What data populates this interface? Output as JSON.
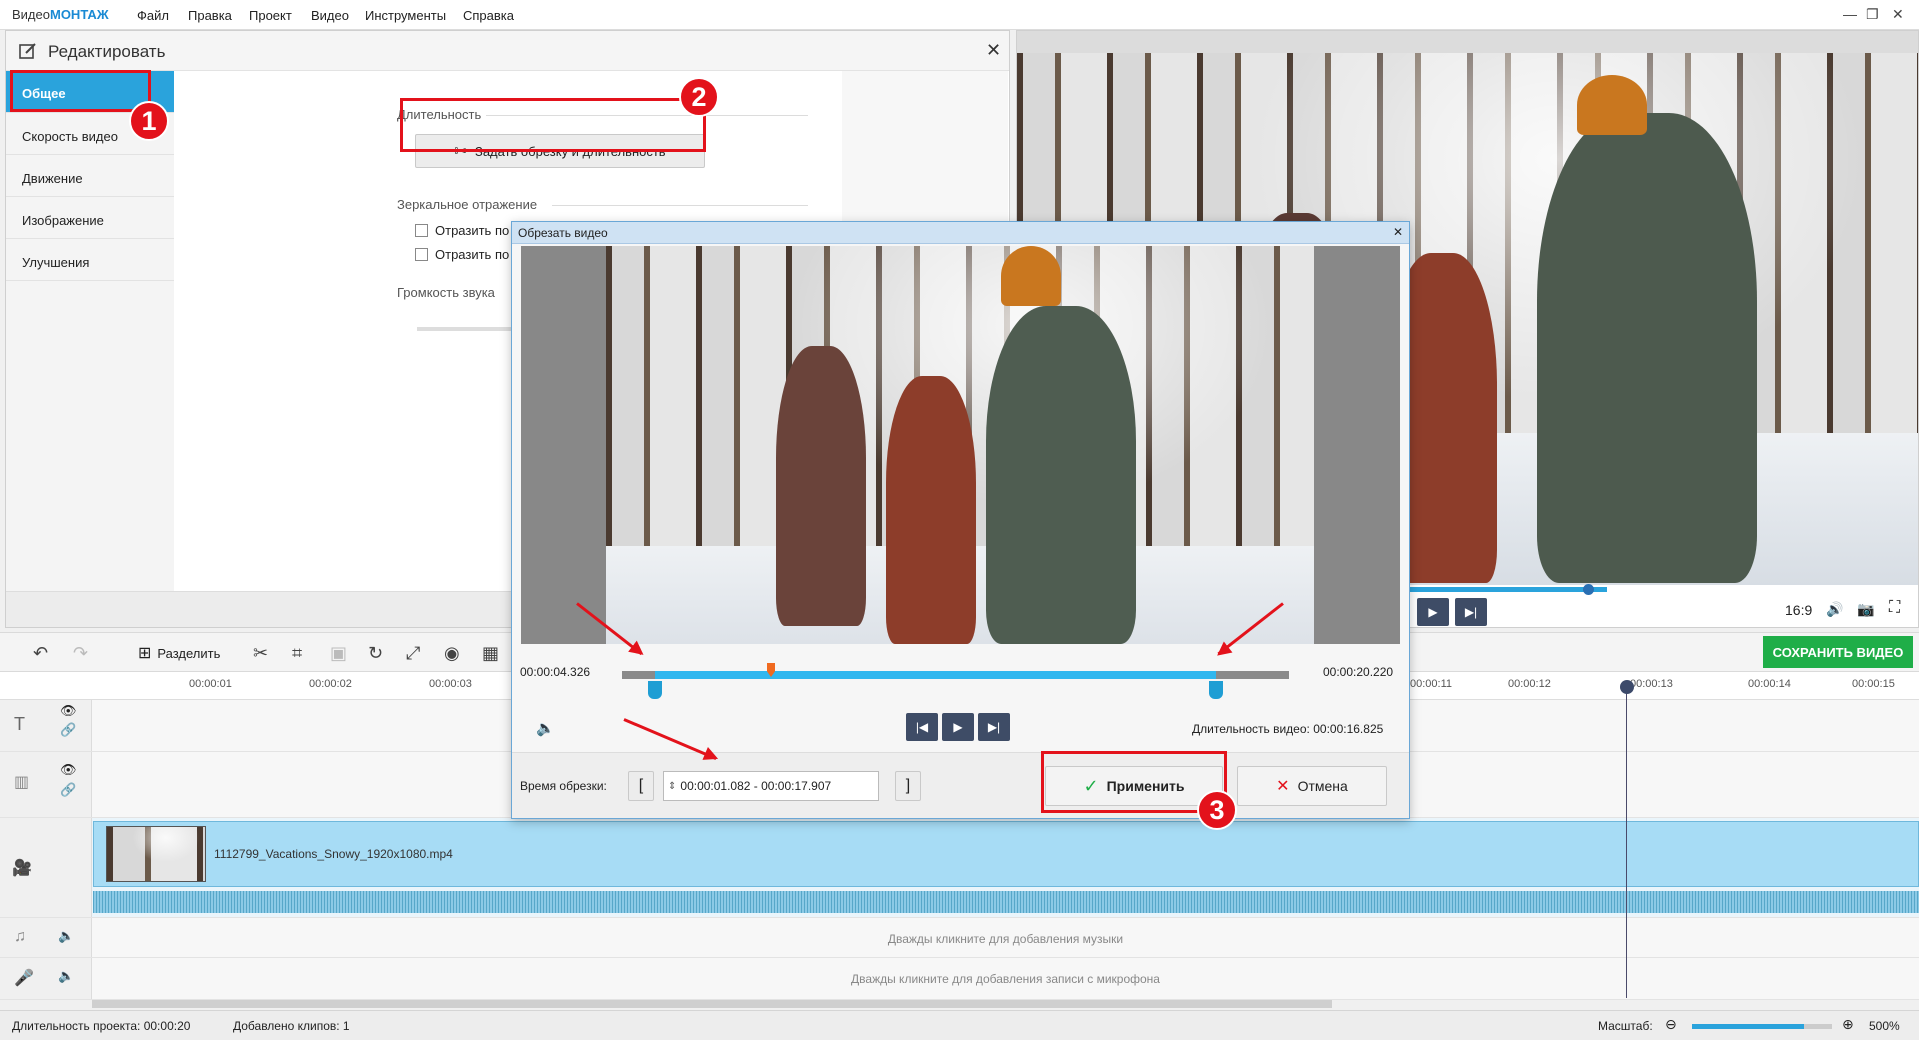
{
  "app": {
    "logo_a": "Видео",
    "logo_b": "МОНТАЖ"
  },
  "menu": [
    "Файл",
    "Правка",
    "Проект",
    "Видео",
    "Инструменты",
    "Справка"
  ],
  "window": {
    "minimize": "—",
    "maximize": "❐",
    "close": "✕"
  },
  "edit": {
    "title": "Редактировать",
    "close": "✕",
    "tabs": [
      "Общее",
      "Скорость видео",
      "Движение",
      "Изображение",
      "Улучшения"
    ],
    "duration_label": "Длительность",
    "trim_button": "Задать обрезку и длительность",
    "mirror_label": "Зеркальное отражение",
    "mirror_h": "Отразить по горизонтали",
    "mirror_v": "Отразить по",
    "volume_label": "Громкость звука"
  },
  "badges": [
    "1",
    "2",
    "3"
  ],
  "preview": {
    "aspect": "16:9",
    "save": "СОХРАНИТЬ ВИДЕО",
    "progress": 0.3
  },
  "dialog": {
    "title": "Обрезать видео",
    "close": "✕",
    "time_start": "00:00:04.326",
    "time_end": "00:00:20.220",
    "duration_label": "Длительность видео:",
    "duration_value": "00:00:16.825",
    "trim_label": "Время обрезки:",
    "trim_value": "00:00:01.082 - 00:00:17.907",
    "bracket_open": "[",
    "bracket_close": "]",
    "apply": "Применить",
    "cancel": "Отмена",
    "trim_start_fraction": 0.05,
    "trim_end_fraction": 0.89
  },
  "toolbar": {
    "split": "Разделить"
  },
  "ruler": [
    "00:00:01",
    "00:00:02",
    "00:00:03",
    "00:00:11",
    "00:00:12",
    "00:00:13",
    "00:00:14",
    "00:00:15"
  ],
  "timeline": {
    "clip_name": "1112799_Vacations_Snowy_1920x1080.mp4",
    "music_hint": "Дважды кликните для добавления музыки",
    "mic_hint": "Дважды кликните для добавления записи с микрофона"
  },
  "status": {
    "duration": "Длительность проекта:  00:00:20",
    "clips": "Добавлено клипов: 1",
    "zoom_label": "Масштаб:",
    "zoom_value": "500%",
    "zoom_level": 0.8
  }
}
